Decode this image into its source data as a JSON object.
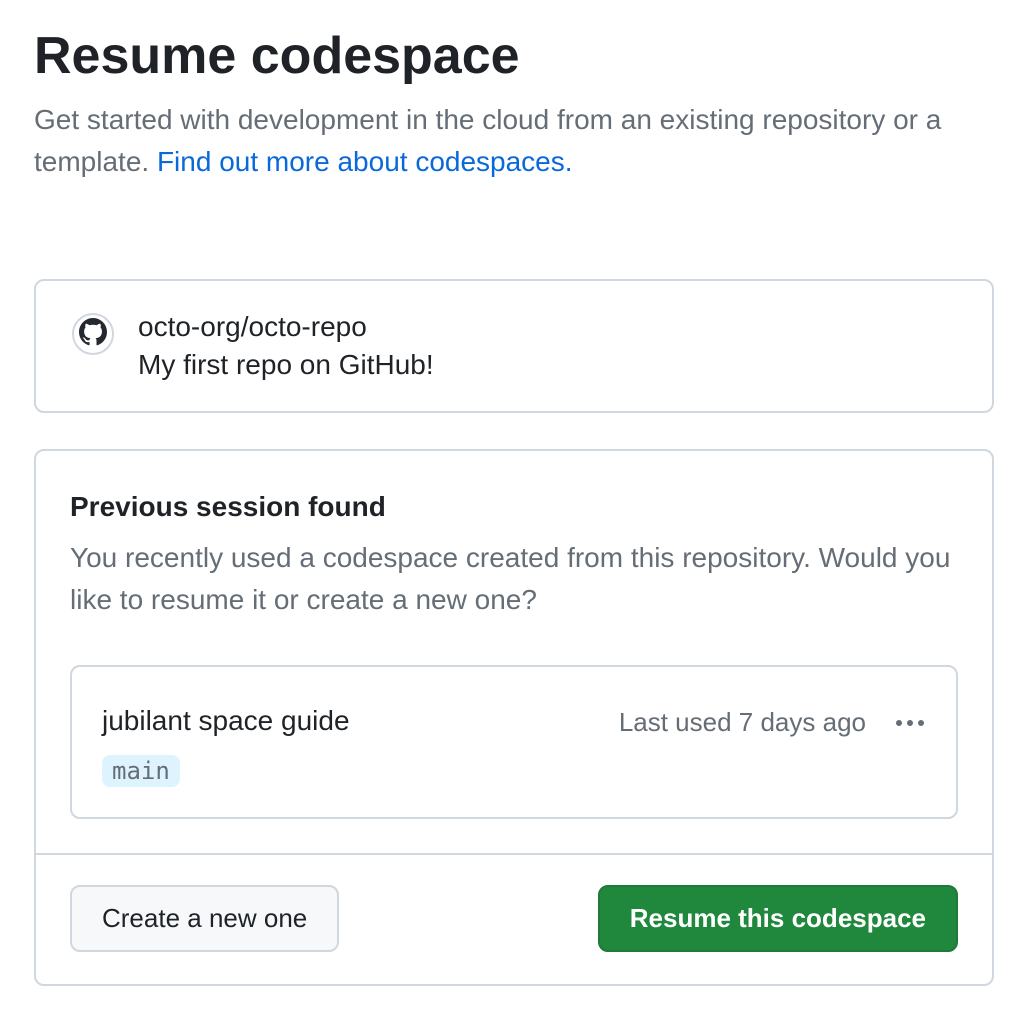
{
  "header": {
    "title": "Resume codespace",
    "subtitle_prefix": "Get started with development in the cloud from an existing repository or a template. ",
    "subtitle_link": "Find out more about codespaces."
  },
  "repo": {
    "full_name": "octo-org/octo-repo",
    "description": "My first repo on GitHub!"
  },
  "session": {
    "heading": "Previous session found",
    "description": "You recently used a codespace created from this repository. Would you like to resume it or create a new one?",
    "codespace": {
      "name": "jubilant space guide",
      "branch": "main",
      "last_used": "Last used 7 days ago"
    },
    "actions": {
      "create_new": "Create a new one",
      "resume": "Resume this codespace"
    }
  }
}
